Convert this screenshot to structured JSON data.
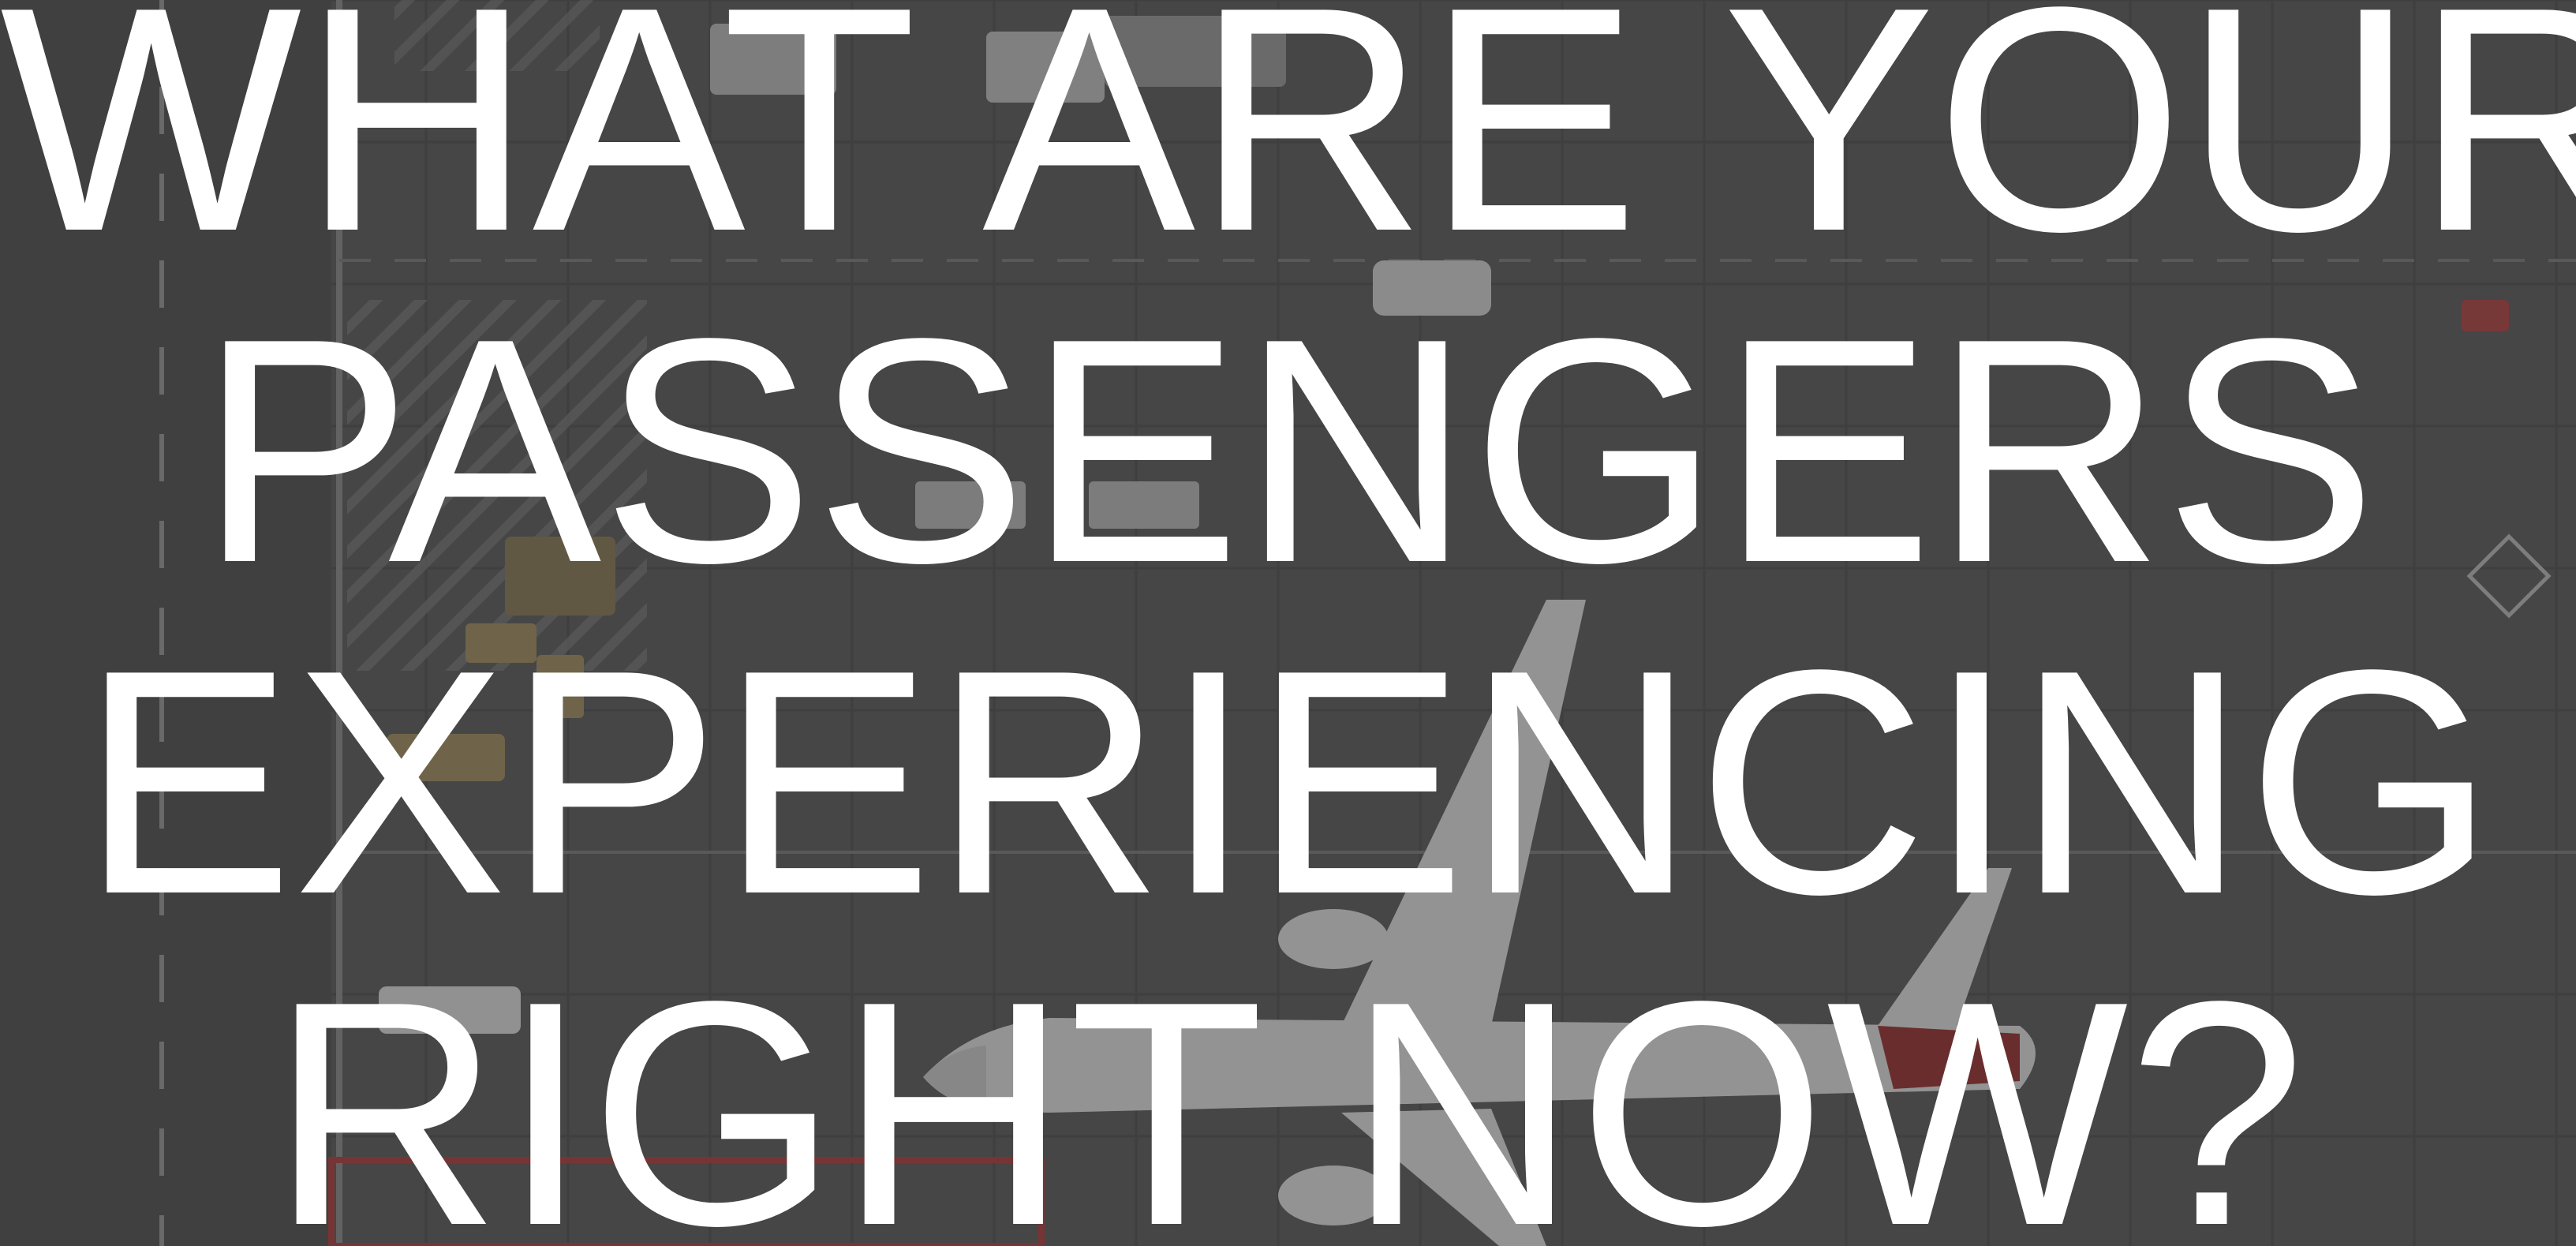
{
  "headline": {
    "line1": "WHAT ARE YOUR",
    "line2": "PASSENGERS",
    "line3": "EXPERIENCING",
    "line4": "RIGHT NOW?"
  },
  "background": {
    "subject": "aerial view of airport apron with parked aircraft and ground service vehicles",
    "overlay_color": "#2f2f2f",
    "tarmac_color": "#555555"
  },
  "text_color": "#ffffff"
}
